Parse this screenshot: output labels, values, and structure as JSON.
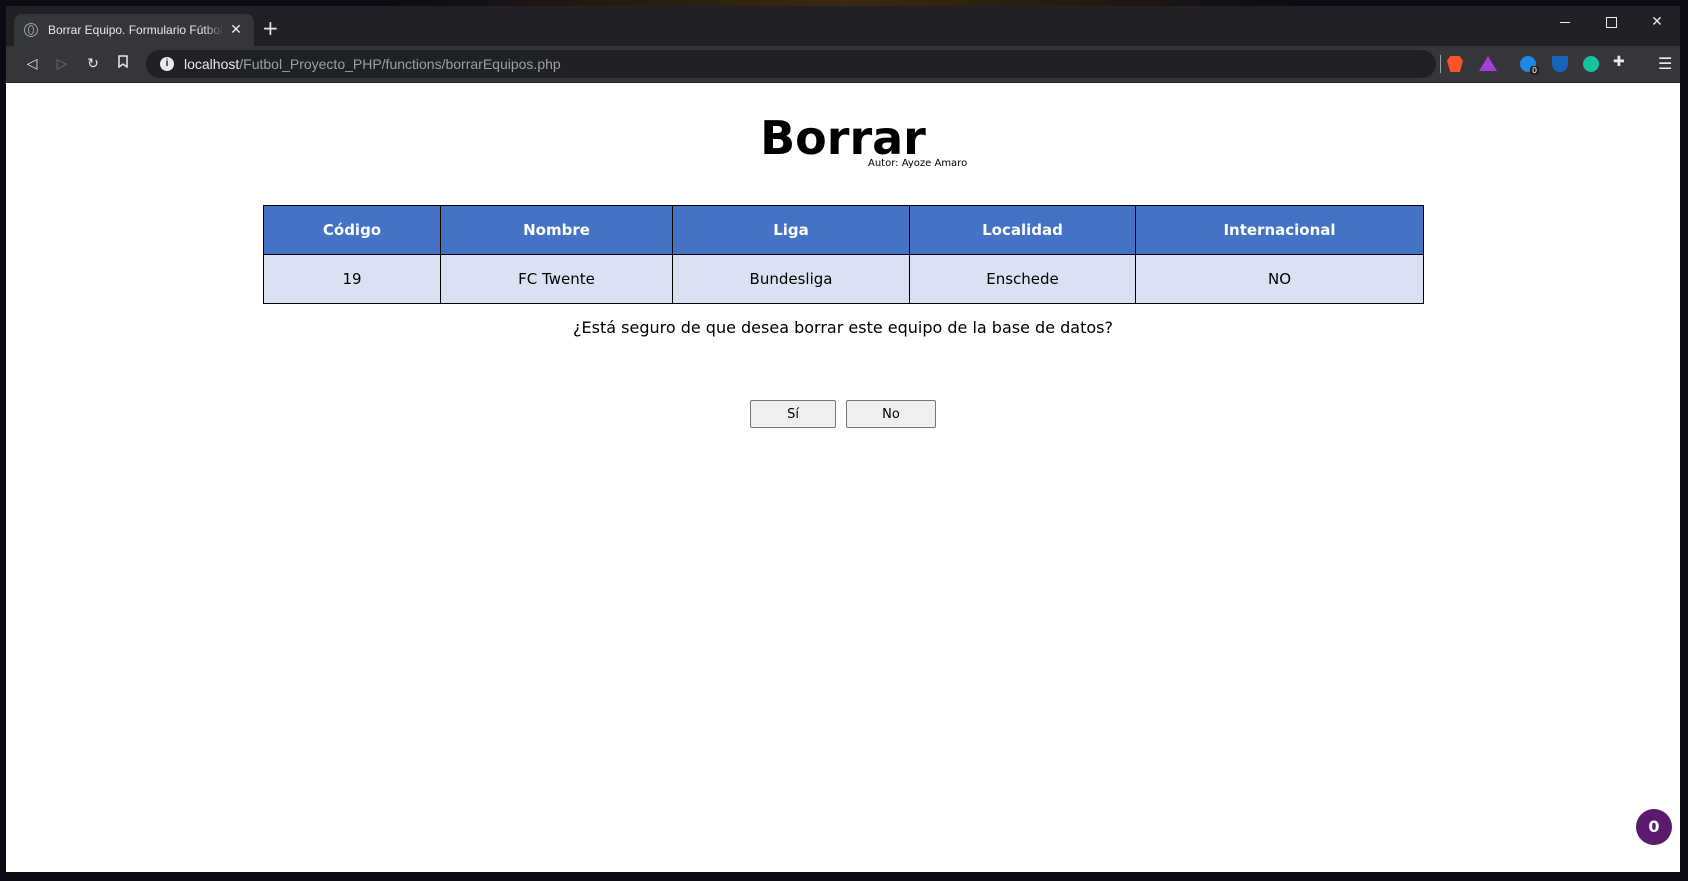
{
  "browser": {
    "tab_title": "Borrar Equipo. Formulario Fútbol P",
    "new_tab": "+",
    "close_tab": "✕",
    "url_host": "localhost",
    "url_path": "/Futbol_Proyecto_PHP/functions/borrarEquipos.php",
    "extension_badge": "0",
    "colors": {
      "titlebar": "#202124",
      "toolbar": "#35363a"
    }
  },
  "page": {
    "title": "Borrar",
    "author": "Autor: Ayoze Amaro",
    "table": {
      "headers": [
        "Código",
        "Nombre",
        "Liga",
        "Localidad",
        "Internacional"
      ],
      "rows": [
        [
          "19",
          "FC Twente",
          "Bundesliga",
          "Enschede",
          "NO"
        ]
      ]
    },
    "question": "¿Está seguro de que desea borrar este equipo de la base de datos?",
    "yes_label": "Sí",
    "no_label": "No",
    "counter": "0",
    "colors": {
      "header_bg": "#4472c4",
      "row_bg": "#d9e1f2",
      "counter_bg": "#5b1a6b"
    }
  }
}
